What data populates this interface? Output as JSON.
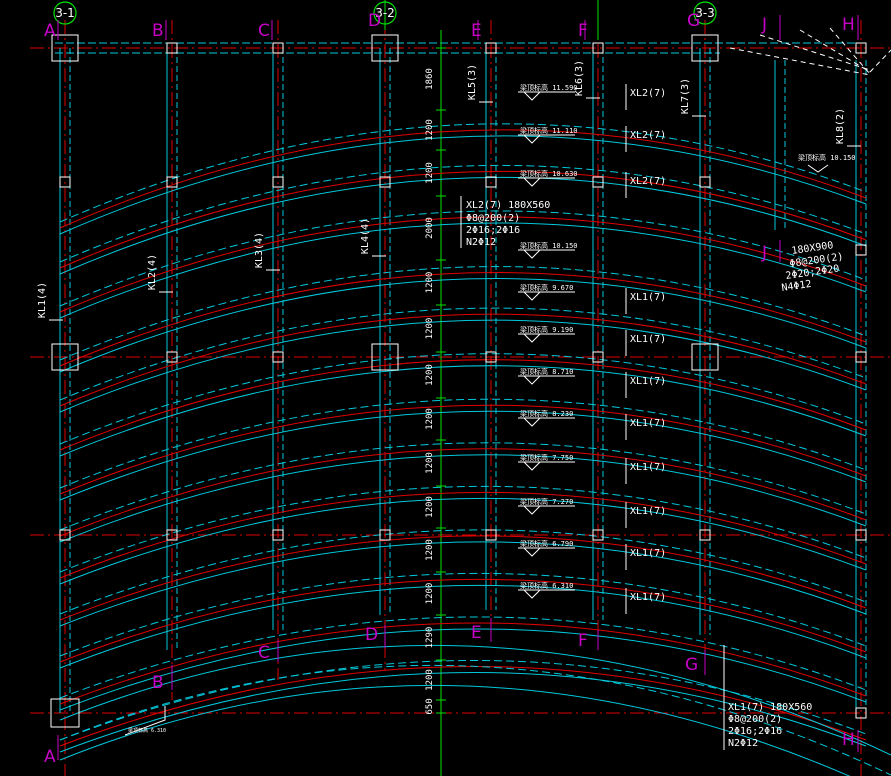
{
  "axis_tags": [
    {
      "label": "3-1"
    },
    {
      "label": "3-2"
    },
    {
      "label": "3-3"
    }
  ],
  "axis_letters_top": [
    "A",
    "B",
    "C",
    "D",
    "E",
    "F",
    "G",
    "J",
    "H"
  ],
  "axis_letters_bottom": [
    "A",
    "B",
    "C",
    "D",
    "E",
    "F",
    "G",
    "H"
  ],
  "axis_letter_mid_j": "J",
  "vertical_beam_labels": [
    "KL1(4)",
    "KL2(4)",
    "KL3(4)",
    "KL4(4)",
    "KL5(3)",
    "KL6(3)",
    "KL7(3)",
    "KL8(2)"
  ],
  "dimensions": [
    "1860",
    "1200",
    "1200",
    "2000",
    "1200",
    "1200",
    "1200",
    "1200",
    "1200",
    "1200",
    "1200",
    "1200",
    "1290",
    "1200",
    "650"
  ],
  "elevations": [
    "11.590",
    "11.110",
    "10.630",
    "10.150",
    "9.670",
    "9.190",
    "8.710",
    "8.230",
    "7.750",
    "7.270",
    "6.790",
    "6.310"
  ],
  "elevation_prefix": "梁顶标高",
  "xl_labels": [
    "XL2(7)",
    "XL2(7)",
    "XL2(7)",
    "XL1(7)",
    "XL1(7)",
    "XL1(7)",
    "XL1(7)",
    "XL1(7)",
    "XL1(7)",
    "XL1(7)",
    "XL1(7)"
  ],
  "note_xl2": [
    "XL2(7) 180X560",
    "Φ8@200(2)",
    "2Φ16;2Φ16",
    "N2Φ12"
  ],
  "note_right": [
    "180X900",
    "Φ8@200(2)",
    "2Φ20;2Φ20",
    "N4Φ12"
  ],
  "note_right_elev": "梁顶标高 10.150",
  "note_xl1": [
    "XL1(7) 180X560",
    "Φ8@200(2)",
    "2Φ16;2Φ16",
    "N2Φ12"
  ],
  "note_small": "梁顶标高 6.310"
}
